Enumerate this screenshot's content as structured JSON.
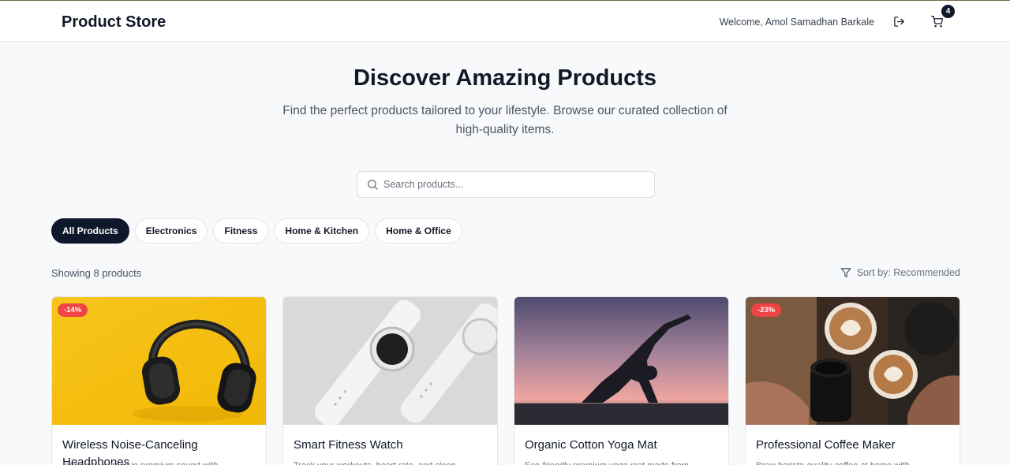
{
  "header": {
    "brand": "Product Store",
    "welcome": "Welcome, Amol Samadhan Barkale",
    "cart_count": "4"
  },
  "hero": {
    "title": "Discover Amazing Products",
    "subtitle": "Find the perfect products tailored to your lifestyle. Browse our curated collection of high-quality items."
  },
  "search": {
    "placeholder": "Search products..."
  },
  "categories": [
    {
      "label": "All Products",
      "active": true
    },
    {
      "label": "Electronics",
      "active": false
    },
    {
      "label": "Fitness",
      "active": false
    },
    {
      "label": "Home & Kitchen",
      "active": false
    },
    {
      "label": "Home & Office",
      "active": false
    }
  ],
  "results": {
    "showing": "Showing 8 products",
    "sort_label": "Sort by: Recommended"
  },
  "products": [
    {
      "title": "Wireless Noise-Canceling Headphones",
      "description": "Immerse yourself in premium sound with",
      "discount": "-14%",
      "image_icon": "headphones-image"
    },
    {
      "title": "Smart Fitness Watch",
      "description": "Track your workouts, heart rate, and sleep",
      "discount": "",
      "image_icon": "smartwatch-image"
    },
    {
      "title": "Organic Cotton Yoga Mat",
      "description": "Eco-friendly premium yoga mat made from",
      "discount": "",
      "image_icon": "yoga-image"
    },
    {
      "title": "Professional Coffee Maker",
      "description": "Brew barista-quality coffee at home with",
      "discount": "-23%",
      "image_icon": "coffee-image"
    }
  ],
  "colors": {
    "accent": "#0f172a",
    "discount_badge": "#ef4444",
    "background": "#f8f9fb"
  }
}
